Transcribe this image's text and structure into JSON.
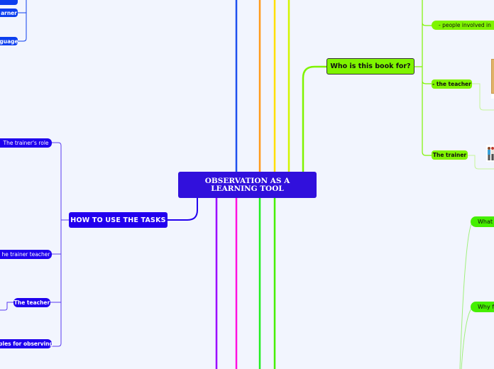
{
  "central_topic": "OBSERVATION AS A LEARNING TOOL",
  "branches": {
    "left": {
      "top_partial": [
        {
          "label": "arner"
        },
        {
          "label": "guage"
        }
      ],
      "how_to_use": {
        "label": "HOW TO USE THE TASKS",
        "color": "#2200ee",
        "children": [
          {
            "label": "The trainer's role"
          },
          {
            "label": "he trainer teacher"
          },
          {
            "label": "The teacher"
          },
          {
            "label": "ples for observing"
          }
        ]
      }
    },
    "right": {
      "who_is_book_for": {
        "label": "Who is this book for?",
        "color": "#7ff400",
        "children": [
          {
            "label": "- people involved in"
          },
          {
            "label": "- the teacher",
            "has_image": "book-image"
          },
          {
            "label": "The trainer",
            "has_image": "people-image"
          }
        ]
      },
      "lower_partial": [
        {
          "label": "What"
        },
        {
          "label": "Why f"
        }
      ]
    }
  },
  "branch_line_colors": {
    "top": [
      "#1e50f0",
      "#ff9a1a",
      "#ffe000",
      "#d4f500",
      "#7ff400"
    ],
    "bottom": [
      "#9b00ff",
      "#ff10e0",
      "#20ee20",
      "#45ef00"
    ],
    "how_to_use": "#2200ee",
    "who_is_book_for": "#7ff400"
  }
}
